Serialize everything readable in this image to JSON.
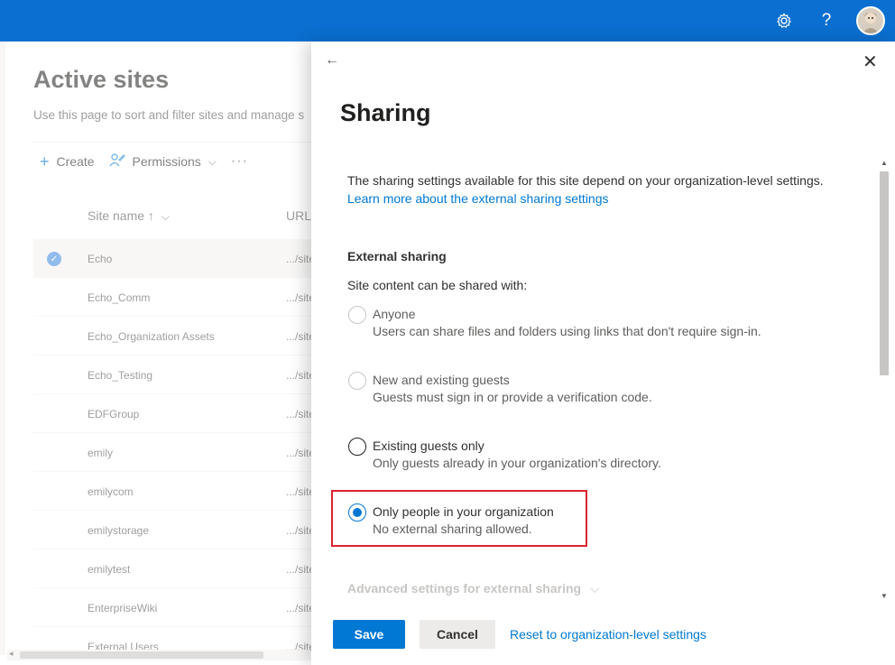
{
  "topbar": {
    "settings_icon": "gear-icon",
    "help_glyph": "?",
    "avatar_icon": "user-avatar"
  },
  "background_page": {
    "title": "Active sites",
    "description": "Use this page to sort and filter sites and manage s",
    "commands": {
      "create": "Create",
      "permissions": "Permissions",
      "more": "···"
    },
    "columns": {
      "site_name": "Site name ↑",
      "url": "URL"
    },
    "rows": [
      {
        "name": "Echo",
        "url": ".../site"
      },
      {
        "name": "Echo_Comm",
        "url": ".../site"
      },
      {
        "name": "Echo_Organization Assets",
        "url": ".../site"
      },
      {
        "name": "Echo_Testing",
        "url": ".../site"
      },
      {
        "name": "EDFGroup",
        "url": ".../site"
      },
      {
        "name": "emily",
        "url": ".../site"
      },
      {
        "name": "emilycom",
        "url": ".../site"
      },
      {
        "name": "emilystorage",
        "url": ".../site"
      },
      {
        "name": "emilytest",
        "url": ".../site"
      },
      {
        "name": "EnterpriseWiki",
        "url": ".../site"
      },
      {
        "name": "External Users",
        "url": ".../site"
      }
    ]
  },
  "panel": {
    "back_glyph": "←",
    "close_glyph": "✕",
    "title": "Sharing",
    "intro": "The sharing settings available for this site depend on your organization-level settings.",
    "learn_more": "Learn more about the external sharing settings",
    "section_title": "External sharing",
    "section_sub": "Site content can be shared with:",
    "options": [
      {
        "label": "Anyone",
        "desc": "Users can share files and folders using links that don't require sign-in."
      },
      {
        "label": "New and existing guests",
        "desc": "Guests must sign in or provide a verification code."
      },
      {
        "label": "Existing guests only",
        "desc": "Only guests already in your organization's directory."
      },
      {
        "label": "Only people in your organization",
        "desc": "No external sharing allowed."
      }
    ],
    "selected_option": "Only people in your organization",
    "advanced": "Advanced settings for external sharing",
    "save": "Save",
    "cancel": "Cancel",
    "reset": "Reset to organization-level settings"
  },
  "colors": {
    "topbar": "#0a6fd0",
    "accent": "#0078d4",
    "highlight": "#d9232e"
  }
}
